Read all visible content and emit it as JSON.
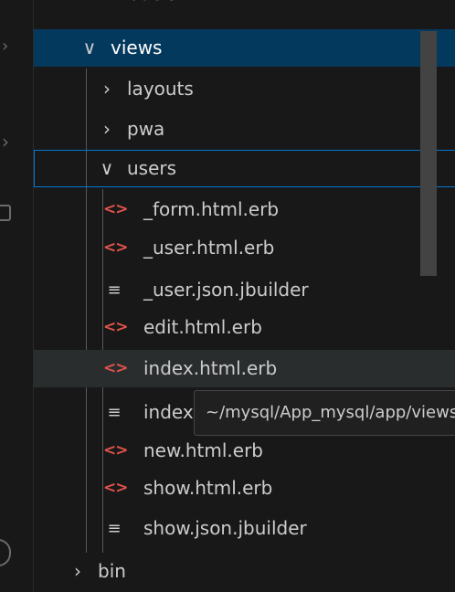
{
  "explorer": {
    "partial_top_label": "models",
    "tree": [
      {
        "label": "views",
        "twisty": "∨"
      },
      {
        "label": "layouts",
        "twisty": "›"
      },
      {
        "label": "pwa",
        "twisty": "›"
      },
      {
        "label": "users",
        "twisty": "∨"
      },
      {
        "label": "_form.html.erb",
        "icon": "<>"
      },
      {
        "label": "_user.html.erb",
        "icon": "<>"
      },
      {
        "label": "_user.json.jbuilder",
        "icon": "≡"
      },
      {
        "label": "edit.html.erb",
        "icon": "<>"
      },
      {
        "label": "index.html.erb",
        "icon": "<>"
      },
      {
        "label": "index.json.jbuilder",
        "icon": "≡"
      },
      {
        "label": "new.html.erb",
        "icon": "<>"
      },
      {
        "label": "show.html.erb",
        "icon": "<>"
      },
      {
        "label": "show.json.jbuilder",
        "icon": "≡"
      },
      {
        "label": "bin",
        "twisty": "›"
      }
    ],
    "tooltip": "~/mysql/App_mysql/app/views/users/index.json.jbuilder"
  },
  "colors": {
    "background": "#181818",
    "selected_row": "#04395e",
    "focus_border": "#0078d4",
    "erb_icon": "#e2534d"
  }
}
